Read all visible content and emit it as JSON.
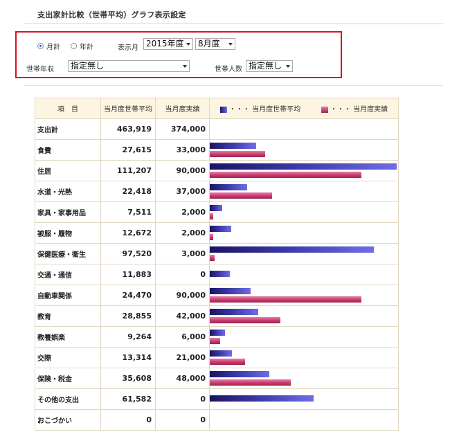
{
  "page": {
    "title": "支出家計比較（世帯平均）グラフ表示設定"
  },
  "filter": {
    "period_options": [
      {
        "label": "月計",
        "selected": true
      },
      {
        "label": "年計",
        "selected": false
      }
    ],
    "display_month_label": "表示月",
    "year_select": "2015年度",
    "month_select": "8月度",
    "income_label": "世帯年収",
    "income_select": "指定無し",
    "members_label": "世帯人数",
    "members_select": "指定無し"
  },
  "table": {
    "headers": {
      "item": "項　目",
      "avg": "当月度世帯平均",
      "actual": "当月度実績",
      "legend_avg": "・・・ 当月度世帯平均",
      "legend_actual": "・・・ 当月度実績"
    },
    "rows": [
      {
        "label": "支出計",
        "avg": "463,919",
        "actual": "374,000",
        "avg_value": 463919,
        "actual_value": 374000,
        "show_bars": false
      },
      {
        "label": "食費",
        "avg": "27,615",
        "actual": "33,000",
        "avg_value": 27615,
        "actual_value": 33000,
        "show_bars": true
      },
      {
        "label": "住居",
        "avg": "111,207",
        "actual": "90,000",
        "avg_value": 111207,
        "actual_value": 90000,
        "show_bars": true
      },
      {
        "label": "水道・光熱",
        "avg": "22,418",
        "actual": "37,000",
        "avg_value": 22418,
        "actual_value": 37000,
        "show_bars": true
      },
      {
        "label": "家具・家事用品",
        "avg": "7,511",
        "actual": "2,000",
        "avg_value": 7511,
        "actual_value": 2000,
        "show_bars": true
      },
      {
        "label": "被服・履物",
        "avg": "12,672",
        "actual": "2,000",
        "avg_value": 12672,
        "actual_value": 2000,
        "show_bars": true
      },
      {
        "label": "保健医療・衛生",
        "avg": "97,520",
        "actual": "3,000",
        "avg_value": 97520,
        "actual_value": 3000,
        "show_bars": true
      },
      {
        "label": "交通・通信",
        "avg": "11,883",
        "actual": "0",
        "avg_value": 11883,
        "actual_value": 0,
        "show_bars": true
      },
      {
        "label": "自動車関係",
        "avg": "24,470",
        "actual": "90,000",
        "avg_value": 24470,
        "actual_value": 90000,
        "show_bars": true
      },
      {
        "label": "教育",
        "avg": "28,855",
        "actual": "42,000",
        "avg_value": 28855,
        "actual_value": 42000,
        "show_bars": true
      },
      {
        "label": "教養娯楽",
        "avg": "9,264",
        "actual": "6,000",
        "avg_value": 9264,
        "actual_value": 6000,
        "show_bars": true
      },
      {
        "label": "交際",
        "avg": "13,314",
        "actual": "21,000",
        "avg_value": 13314,
        "actual_value": 21000,
        "show_bars": true
      },
      {
        "label": "保険・税金",
        "avg": "35,608",
        "actual": "48,000",
        "avg_value": 35608,
        "actual_value": 48000,
        "show_bars": true
      },
      {
        "label": "その他の支出",
        "avg": "61,582",
        "actual": "0",
        "avg_value": 61582,
        "actual_value": 0,
        "show_bars": true
      },
      {
        "label": "おこづかい",
        "avg": "0",
        "actual": "0",
        "avg_value": 0,
        "actual_value": 0,
        "show_bars": true
      }
    ],
    "bar_max": 111207
  },
  "colors": {
    "accent_border": "#d8141c",
    "avg_bar": "#3a37a6",
    "actual_bar": "#c73a6e",
    "header_bg": "#fdf5e1"
  }
}
